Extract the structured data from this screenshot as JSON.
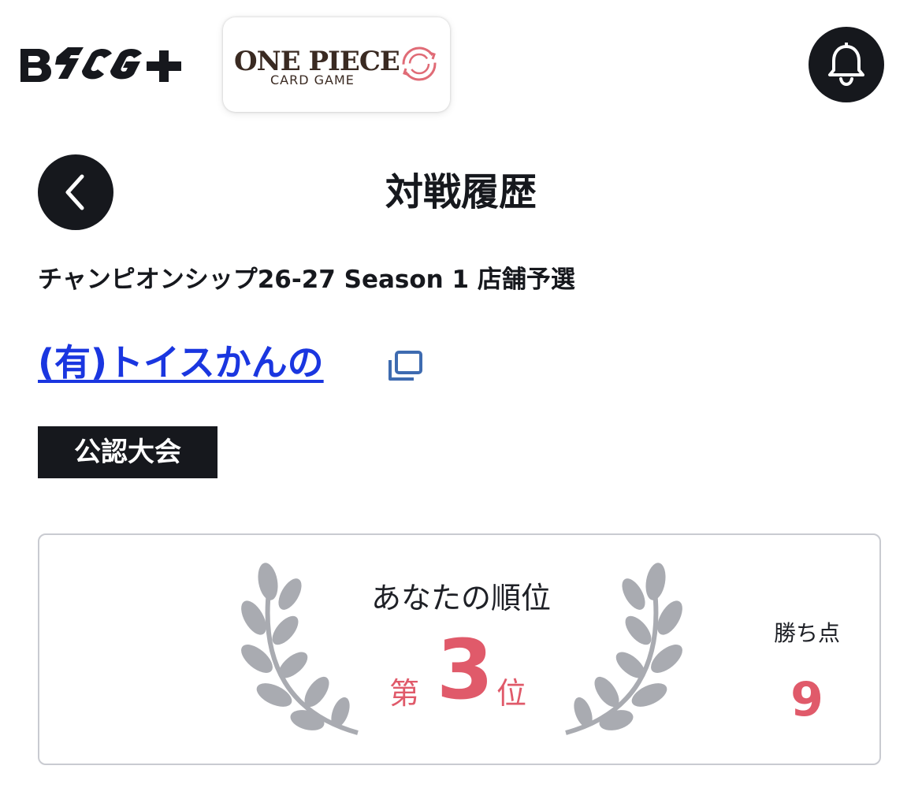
{
  "header": {
    "app_logo": "BTCG+",
    "game_logo_title": "ONE PIECE",
    "game_logo_subtitle": "CARD GAME",
    "notification_icon": "bell-icon"
  },
  "nav": {
    "back_icon": "chevron-left-icon",
    "title": "対戦履歴"
  },
  "event": {
    "name": "チャンピオンシップ26-27 Season 1 店舗予選",
    "store_name": "(有)トイスかんの",
    "store_link_icon": "external-window-icon",
    "badge": "公認大会"
  },
  "result": {
    "rank_label": "あなたの順位",
    "rank_prefix": "第",
    "rank_value": "3",
    "rank_suffix": "位",
    "points_label": "勝ち点",
    "points_value": "9"
  },
  "colors": {
    "accent": "#e05a6a",
    "dark": "#16181d",
    "link": "#1a36e0",
    "laurel": "#a9abb1"
  }
}
